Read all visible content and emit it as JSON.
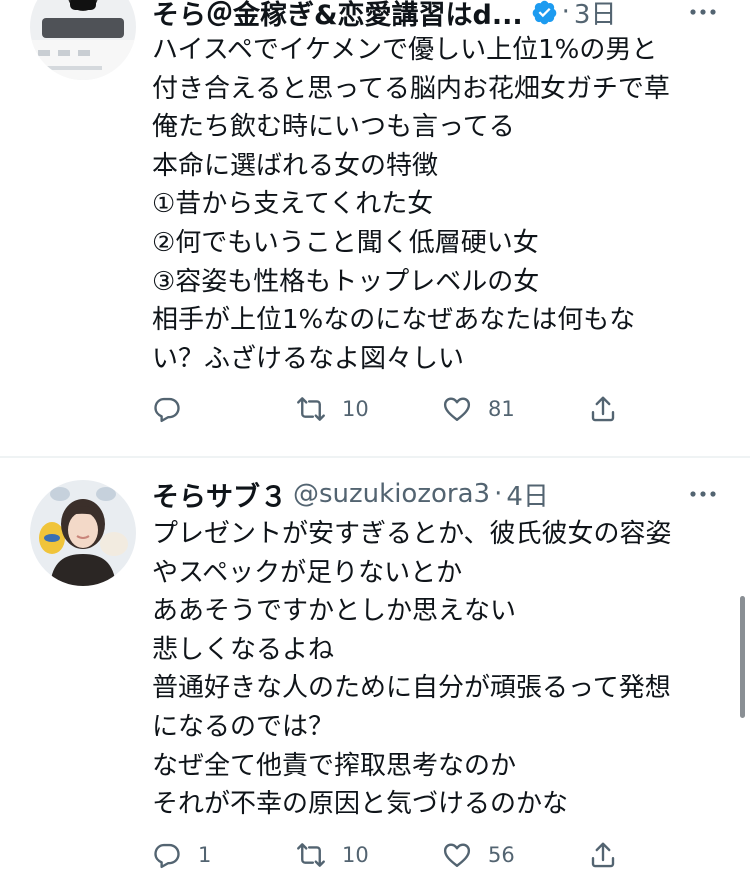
{
  "tweets": [
    {
      "display_name": "そら＠金稼ぎ&恋愛講習はd...",
      "verified": true,
      "handle": "",
      "dot": "·",
      "time": "3日",
      "lines": [
        "ハイスペでイケメンで優しい上位1%の男と",
        "付き合えると思ってる脳内お花畑女ガチで草",
        "俺たち飲む時にいつも言ってる",
        "本命に選ばれる女の特徴",
        "①昔から支えてくれた女",
        "②何でもいうこと聞く低層硬い女",
        "③容姿も性格もトップレベルの女",
        "相手が上位1%なのになぜあなたは何もな",
        "い？ふざけるなよ図々しい"
      ],
      "actions": {
        "reply": "",
        "retweet": "10",
        "like": "81"
      }
    },
    {
      "display_name": "そらサブ３",
      "verified": false,
      "handle": "@suzukiozora3",
      "dot": "·",
      "time": "4日",
      "lines": [
        "プレゼントが安すぎるとか、彼氏彼女の容姿",
        "やスペックが足りないとか",
        "ああそうですかとしか思えない",
        "悲しくなるよね",
        "普通好きな人のために自分が頑張るって発想",
        "になるのでは？",
        "なぜ全て他責で搾取思考なのか",
        "それが不幸の原因と気づけるのかな"
      ],
      "actions": {
        "reply": "1",
        "retweet": "10",
        "like": "56"
      }
    }
  ],
  "icons": {
    "reply": "reply-icon",
    "retweet": "retweet-icon",
    "like": "heart-icon",
    "share": "share-icon",
    "more": "more-icon",
    "verified": "verified-badge-icon"
  },
  "colors": {
    "text": "#0f1419",
    "secondary": "#536471",
    "verified": "#1d9bf0",
    "divider": "#eff3f4"
  }
}
